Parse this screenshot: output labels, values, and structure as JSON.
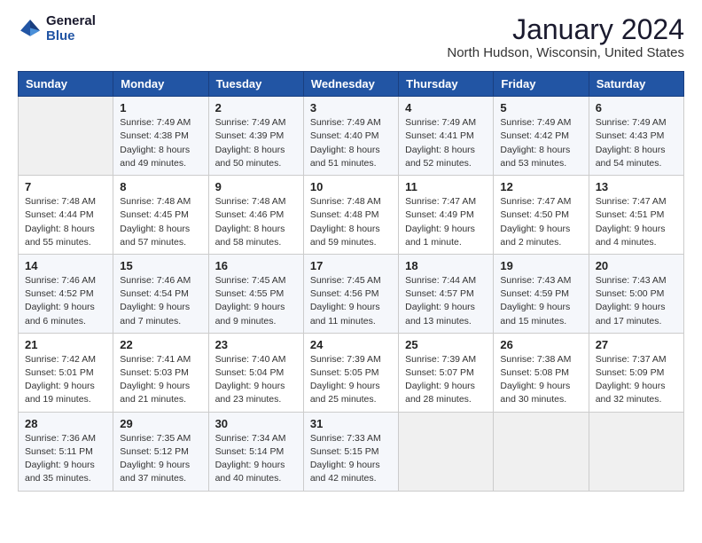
{
  "logo": {
    "line1": "General",
    "line2": "Blue"
  },
  "title": "January 2024",
  "subtitle": "North Hudson, Wisconsin, United States",
  "days_header": [
    "Sunday",
    "Monday",
    "Tuesday",
    "Wednesday",
    "Thursday",
    "Friday",
    "Saturday"
  ],
  "weeks": [
    [
      {
        "day": "",
        "info": ""
      },
      {
        "day": "1",
        "info": "Sunrise: 7:49 AM\nSunset: 4:38 PM\nDaylight: 8 hours\nand 49 minutes."
      },
      {
        "day": "2",
        "info": "Sunrise: 7:49 AM\nSunset: 4:39 PM\nDaylight: 8 hours\nand 50 minutes."
      },
      {
        "day": "3",
        "info": "Sunrise: 7:49 AM\nSunset: 4:40 PM\nDaylight: 8 hours\nand 51 minutes."
      },
      {
        "day": "4",
        "info": "Sunrise: 7:49 AM\nSunset: 4:41 PM\nDaylight: 8 hours\nand 52 minutes."
      },
      {
        "day": "5",
        "info": "Sunrise: 7:49 AM\nSunset: 4:42 PM\nDaylight: 8 hours\nand 53 minutes."
      },
      {
        "day": "6",
        "info": "Sunrise: 7:49 AM\nSunset: 4:43 PM\nDaylight: 8 hours\nand 54 minutes."
      }
    ],
    [
      {
        "day": "7",
        "info": "Sunrise: 7:48 AM\nSunset: 4:44 PM\nDaylight: 8 hours\nand 55 minutes."
      },
      {
        "day": "8",
        "info": "Sunrise: 7:48 AM\nSunset: 4:45 PM\nDaylight: 8 hours\nand 57 minutes."
      },
      {
        "day": "9",
        "info": "Sunrise: 7:48 AM\nSunset: 4:46 PM\nDaylight: 8 hours\nand 58 minutes."
      },
      {
        "day": "10",
        "info": "Sunrise: 7:48 AM\nSunset: 4:48 PM\nDaylight: 8 hours\nand 59 minutes."
      },
      {
        "day": "11",
        "info": "Sunrise: 7:47 AM\nSunset: 4:49 PM\nDaylight: 9 hours\nand 1 minute."
      },
      {
        "day": "12",
        "info": "Sunrise: 7:47 AM\nSunset: 4:50 PM\nDaylight: 9 hours\nand 2 minutes."
      },
      {
        "day": "13",
        "info": "Sunrise: 7:47 AM\nSunset: 4:51 PM\nDaylight: 9 hours\nand 4 minutes."
      }
    ],
    [
      {
        "day": "14",
        "info": "Sunrise: 7:46 AM\nSunset: 4:52 PM\nDaylight: 9 hours\nand 6 minutes."
      },
      {
        "day": "15",
        "info": "Sunrise: 7:46 AM\nSunset: 4:54 PM\nDaylight: 9 hours\nand 7 minutes."
      },
      {
        "day": "16",
        "info": "Sunrise: 7:45 AM\nSunset: 4:55 PM\nDaylight: 9 hours\nand 9 minutes."
      },
      {
        "day": "17",
        "info": "Sunrise: 7:45 AM\nSunset: 4:56 PM\nDaylight: 9 hours\nand 11 minutes."
      },
      {
        "day": "18",
        "info": "Sunrise: 7:44 AM\nSunset: 4:57 PM\nDaylight: 9 hours\nand 13 minutes."
      },
      {
        "day": "19",
        "info": "Sunrise: 7:43 AM\nSunset: 4:59 PM\nDaylight: 9 hours\nand 15 minutes."
      },
      {
        "day": "20",
        "info": "Sunrise: 7:43 AM\nSunset: 5:00 PM\nDaylight: 9 hours\nand 17 minutes."
      }
    ],
    [
      {
        "day": "21",
        "info": "Sunrise: 7:42 AM\nSunset: 5:01 PM\nDaylight: 9 hours\nand 19 minutes."
      },
      {
        "day": "22",
        "info": "Sunrise: 7:41 AM\nSunset: 5:03 PM\nDaylight: 9 hours\nand 21 minutes."
      },
      {
        "day": "23",
        "info": "Sunrise: 7:40 AM\nSunset: 5:04 PM\nDaylight: 9 hours\nand 23 minutes."
      },
      {
        "day": "24",
        "info": "Sunrise: 7:39 AM\nSunset: 5:05 PM\nDaylight: 9 hours\nand 25 minutes."
      },
      {
        "day": "25",
        "info": "Sunrise: 7:39 AM\nSunset: 5:07 PM\nDaylight: 9 hours\nand 28 minutes."
      },
      {
        "day": "26",
        "info": "Sunrise: 7:38 AM\nSunset: 5:08 PM\nDaylight: 9 hours\nand 30 minutes."
      },
      {
        "day": "27",
        "info": "Sunrise: 7:37 AM\nSunset: 5:09 PM\nDaylight: 9 hours\nand 32 minutes."
      }
    ],
    [
      {
        "day": "28",
        "info": "Sunrise: 7:36 AM\nSunset: 5:11 PM\nDaylight: 9 hours\nand 35 minutes."
      },
      {
        "day": "29",
        "info": "Sunrise: 7:35 AM\nSunset: 5:12 PM\nDaylight: 9 hours\nand 37 minutes."
      },
      {
        "day": "30",
        "info": "Sunrise: 7:34 AM\nSunset: 5:14 PM\nDaylight: 9 hours\nand 40 minutes."
      },
      {
        "day": "31",
        "info": "Sunrise: 7:33 AM\nSunset: 5:15 PM\nDaylight: 9 hours\nand 42 minutes."
      },
      {
        "day": "",
        "info": ""
      },
      {
        "day": "",
        "info": ""
      },
      {
        "day": "",
        "info": ""
      }
    ]
  ]
}
